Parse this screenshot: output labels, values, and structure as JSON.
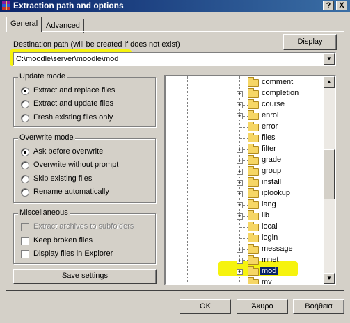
{
  "window": {
    "title": "Extraction path and options",
    "help_btn": "?",
    "close_btn": "X"
  },
  "tabs": [
    {
      "label": "General"
    },
    {
      "label": "Advanced"
    }
  ],
  "destination": {
    "label": "Destination path (will be created if does not exist)",
    "value": "C:\\moodle\\server\\moodle\\mod",
    "display_button": "Display"
  },
  "update_mode": {
    "title": "Update mode",
    "options": [
      {
        "label": "Extract and replace files",
        "selected": true
      },
      {
        "label": "Extract and update files",
        "selected": false
      },
      {
        "label": "Fresh existing files only",
        "selected": false
      }
    ]
  },
  "overwrite_mode": {
    "title": "Overwrite mode",
    "options": [
      {
        "label": "Ask before overwrite",
        "selected": true
      },
      {
        "label": "Overwrite without prompt",
        "selected": false
      },
      {
        "label": "Skip existing files",
        "selected": false
      },
      {
        "label": "Rename automatically",
        "selected": false
      }
    ]
  },
  "misc": {
    "title": "Miscellaneous",
    "options": [
      {
        "label": "Extract archives to subfolders",
        "checked": false,
        "disabled": true
      },
      {
        "label": "Keep broken files",
        "checked": false,
        "disabled": false
      },
      {
        "label": "Display files in Explorer",
        "checked": false,
        "disabled": false
      }
    ]
  },
  "save_settings": "Save settings",
  "tree": {
    "items": [
      {
        "label": "comment",
        "expandable": false,
        "selected": false
      },
      {
        "label": "completion",
        "expandable": true,
        "selected": false
      },
      {
        "label": "course",
        "expandable": true,
        "selected": false
      },
      {
        "label": "enrol",
        "expandable": true,
        "selected": false
      },
      {
        "label": "error",
        "expandable": false,
        "selected": false
      },
      {
        "label": "files",
        "expandable": false,
        "selected": false
      },
      {
        "label": "filter",
        "expandable": true,
        "selected": false
      },
      {
        "label": "grade",
        "expandable": true,
        "selected": false
      },
      {
        "label": "group",
        "expandable": true,
        "selected": false
      },
      {
        "label": "install",
        "expandable": true,
        "selected": false
      },
      {
        "label": "iplookup",
        "expandable": true,
        "selected": false
      },
      {
        "label": "lang",
        "expandable": true,
        "selected": false
      },
      {
        "label": "lib",
        "expandable": true,
        "selected": false
      },
      {
        "label": "local",
        "expandable": false,
        "selected": false
      },
      {
        "label": "login",
        "expandable": false,
        "selected": false
      },
      {
        "label": "message",
        "expandable": true,
        "selected": false
      },
      {
        "label": "mnet",
        "expandable": true,
        "selected": false
      },
      {
        "label": "mod",
        "expandable": true,
        "selected": true
      },
      {
        "label": "my",
        "expandable": false,
        "selected": false
      }
    ]
  },
  "buttons": {
    "ok": "OK",
    "cancel": "Άκυρο",
    "help": "Βοήθεια"
  },
  "colors": {
    "highlight": "#f6f30e",
    "selection": "#0a246a",
    "title_bar": "#0a246a",
    "folder": "#f6d665"
  }
}
